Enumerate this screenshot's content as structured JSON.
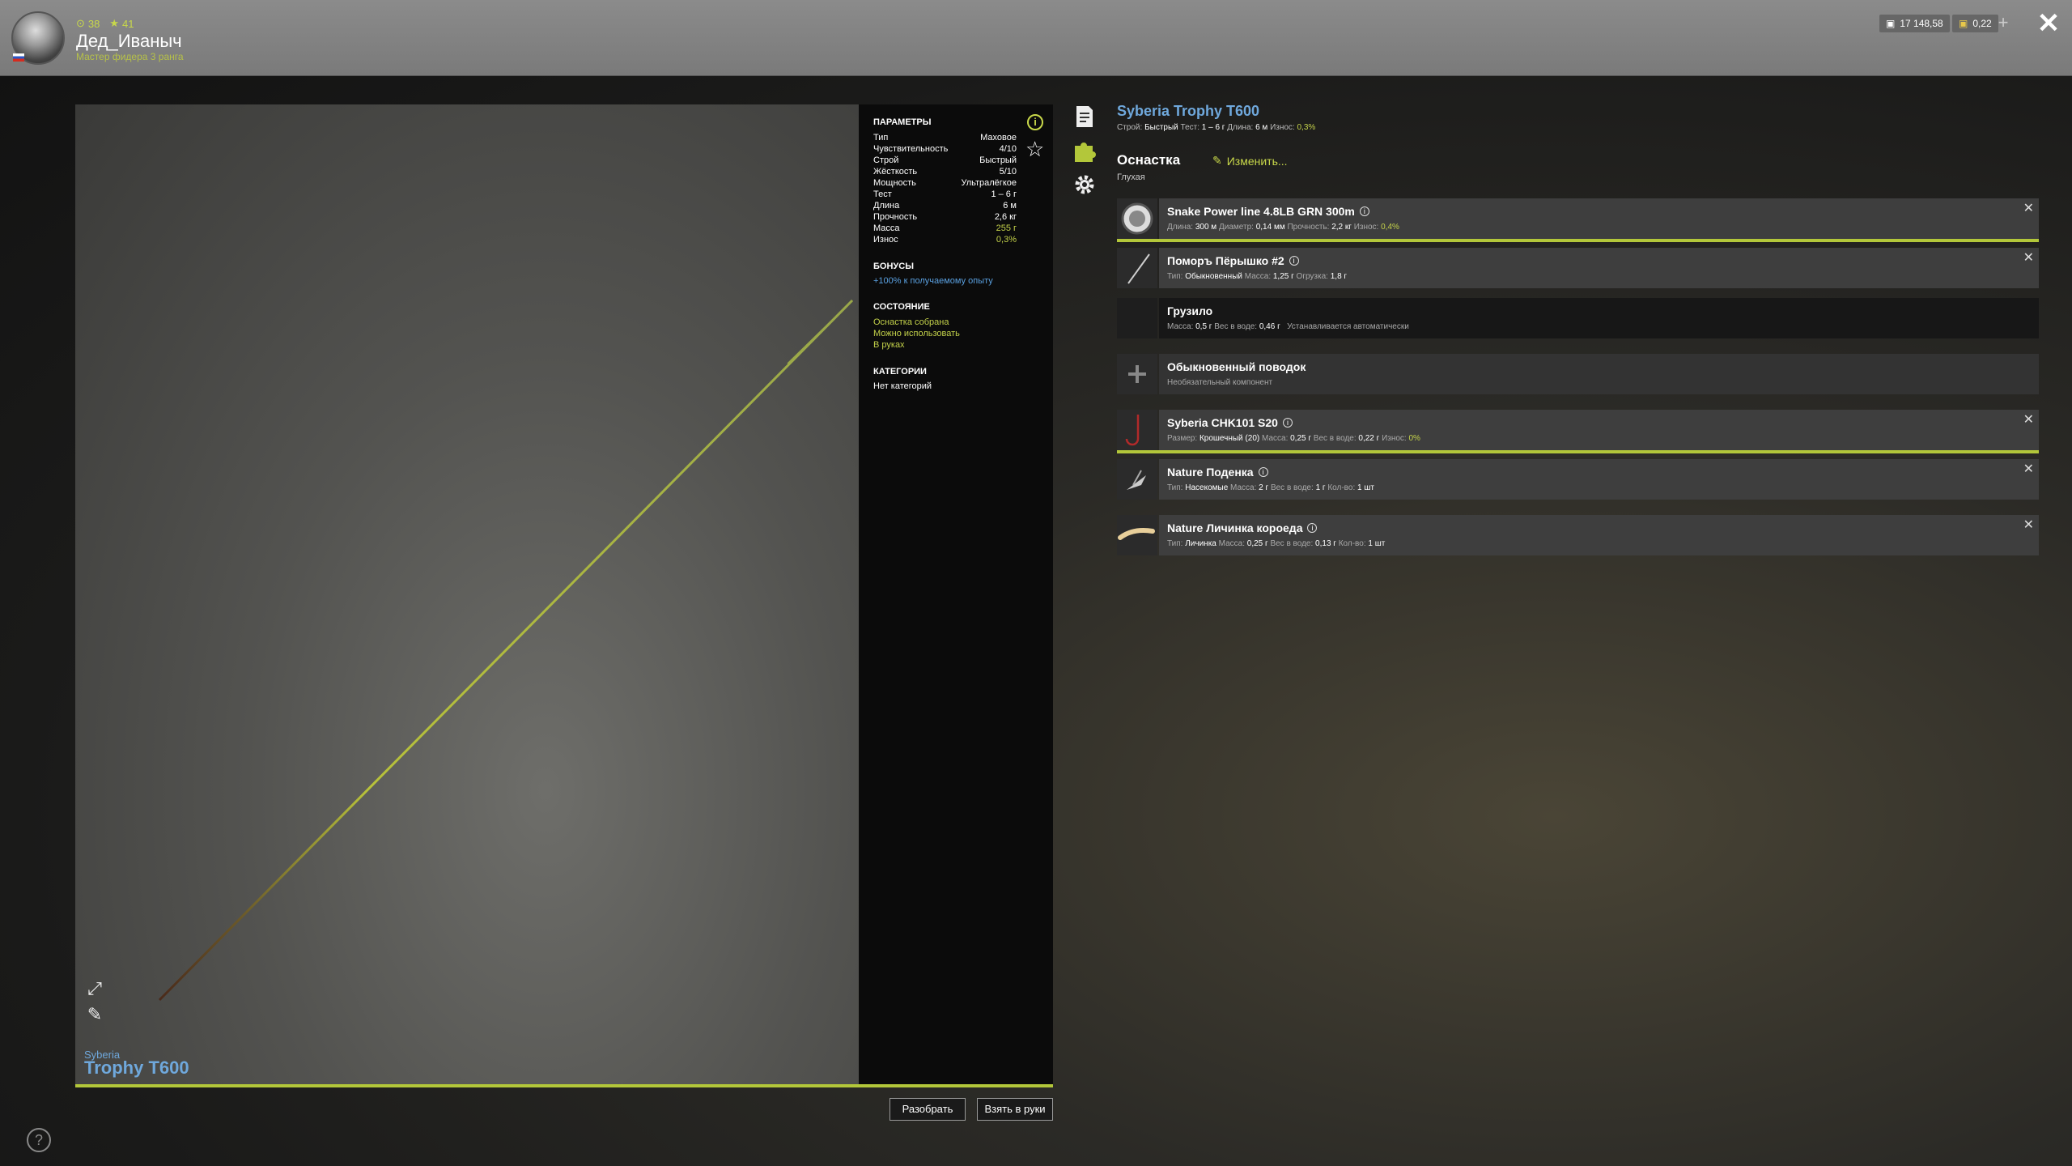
{
  "player": {
    "coins": "38",
    "level": "41",
    "name": "Дед_Иваныч",
    "rank": "Мастер фидера 3 ранга"
  },
  "currency": {
    "silver": "17 148,58",
    "gold": "0,22"
  },
  "preview": {
    "brand": "Syberia",
    "model": "Trophy T600"
  },
  "info": {
    "params_title": "ПАРАМЕТРЫ",
    "params": [
      {
        "label": "Тип",
        "value": "Маховое"
      },
      {
        "label": "Чувствительность",
        "value": "4/10"
      },
      {
        "label": "Строй",
        "value": "Быстрый"
      },
      {
        "label": "Жёсткость",
        "value": "5/10"
      },
      {
        "label": "Мощность",
        "value": "Ультралёгкое"
      },
      {
        "label": "Тест",
        "value": "1 – 6 г"
      },
      {
        "label": "Длина",
        "value": "6 м"
      },
      {
        "label": "Прочность",
        "value": "2,6 кг"
      },
      {
        "label": "Масса",
        "value": "255 г"
      },
      {
        "label": "Износ",
        "value": "0,3%"
      }
    ],
    "bonus_title": "БОНУСЫ",
    "bonus": "+100% к получаемому опыту",
    "state_title": "СОСТОЯНИЕ",
    "states": [
      "Оснастка собрана",
      "Можно использовать",
      "В руках"
    ],
    "cat_title": "КАТЕГОРИИ",
    "categories": "Нет категорий"
  },
  "buttons": {
    "disassemble": "Разобрать",
    "take": "Взять в руки"
  },
  "details": {
    "title": "Syberia Trophy T600",
    "sub": {
      "build_label": "Строй:",
      "build": "Быстрый",
      "test_label": "Тест:",
      "test": "1 – 6 г",
      "len_label": "Длина:",
      "len": "6 м",
      "wear_label": "Износ:",
      "wear": "0,3%"
    },
    "rig_title": "Оснастка",
    "rig_type": "Глухая",
    "change": "Изменить..."
  },
  "slots": {
    "line": {
      "name": "Snake Power line 4.8LB GRN 300m",
      "l1": "Длина:",
      "v1": "300 м",
      "l2": "Диаметр:",
      "v2": "0,14 мм",
      "l3": "Прочность:",
      "v3": "2,2 кг",
      "l4": "Износ:",
      "v4": "0,4%"
    },
    "float": {
      "name": "Поморъ Пёрышко #2",
      "l1": "Тип:",
      "v1": "Обыкновенный",
      "l2": "Масса:",
      "v2": "1,25 г",
      "l3": "Огрузка:",
      "v3": "1,8 г"
    },
    "sinker": {
      "name": "Грузило",
      "l1": "Масса:",
      "v1": "0,5 г",
      "l2": "Вес в воде:",
      "v2": "0,46 г",
      "note": "Устанавливается автоматически"
    },
    "leader": {
      "name": "Обыкновенный поводок",
      "note": "Необязательный компонент"
    },
    "hook": {
      "name": "Syberia CHK101 S20",
      "l1": "Размер:",
      "v1": "Крошечный (20)",
      "l2": "Масса:",
      "v2": "0,25 г",
      "l3": "Вес в воде:",
      "v3": "0,22 г",
      "l4": "Износ:",
      "v4": "0%"
    },
    "bait1": {
      "name": "Nature Поденка",
      "l1": "Тип:",
      "v1": "Насекомые",
      "l2": "Масса:",
      "v2": "2 г",
      "l3": "Вес в воде:",
      "v3": "1 г",
      "l4": "Кол-во:",
      "v4": "1 шт"
    },
    "bait2": {
      "name": "Nature Личинка короеда",
      "l1": "Тип:",
      "v1": "Личинка",
      "l2": "Масса:",
      "v2": "0,25 г",
      "l3": "Вес в воде:",
      "v3": "0,13 г",
      "l4": "Кол-во:",
      "v4": "1 шт"
    }
  },
  "colors": {
    "accent": "#b3c73a",
    "link": "#6fa8dc"
  }
}
